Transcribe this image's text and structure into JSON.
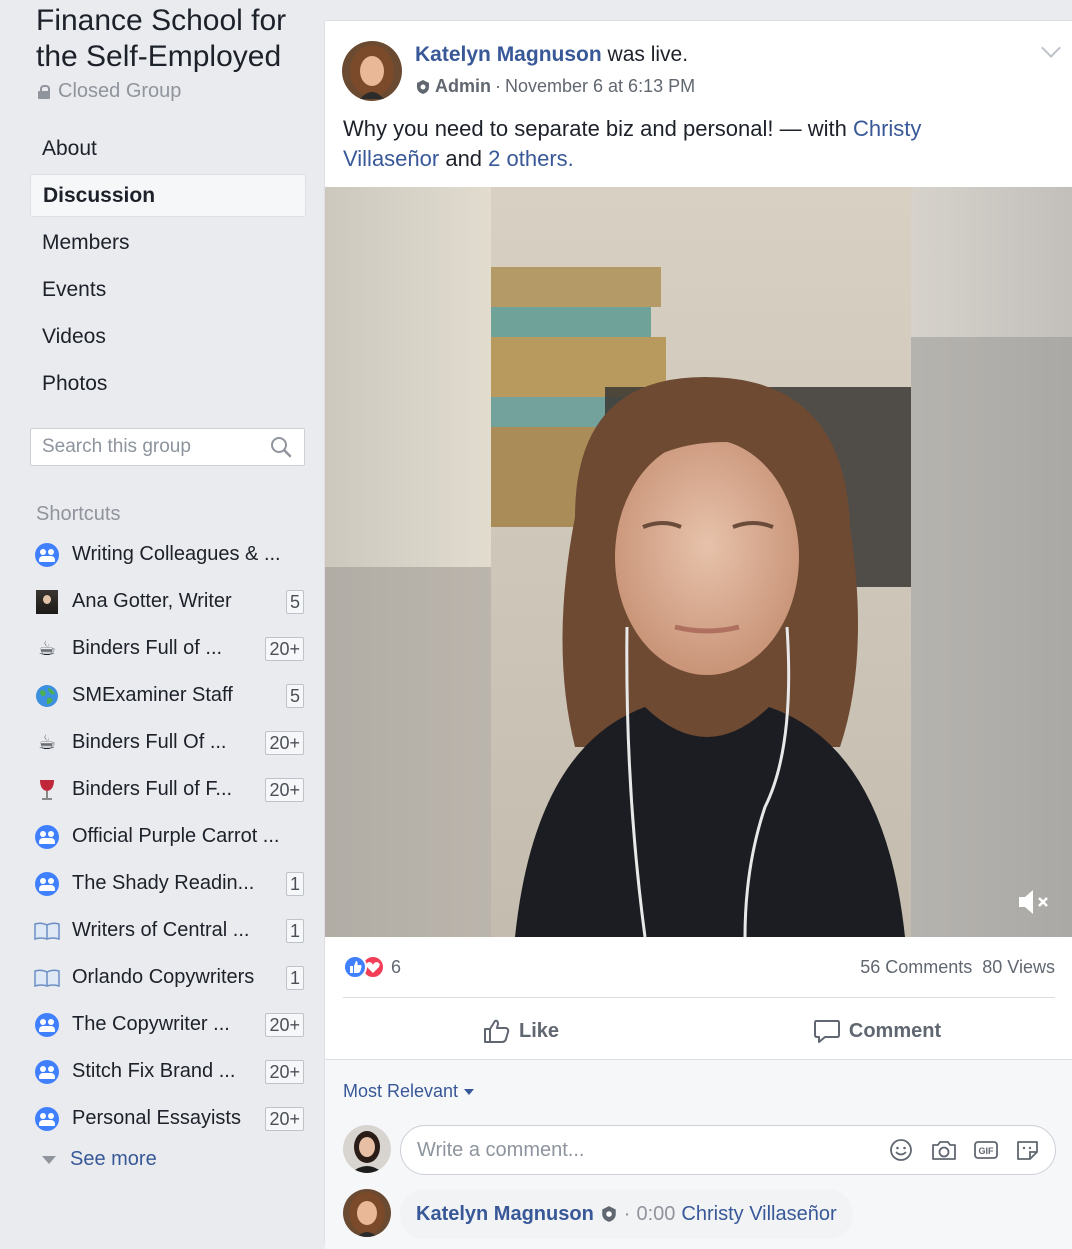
{
  "sidebar": {
    "group_title": "Finance School for the Self-Employed",
    "privacy": "Closed Group",
    "nav": [
      "About",
      "Discussion",
      "Members",
      "Events",
      "Videos",
      "Photos"
    ],
    "active_nav": "Discussion",
    "search_placeholder": "Search this group",
    "shortcuts_heading": "Shortcuts",
    "shortcuts": [
      {
        "label": "Writing Colleagues & ...",
        "badge": "",
        "icon": "group-icon"
      },
      {
        "label": "Ana Gotter, Writer",
        "badge": "5",
        "icon": "profile-thumb-icon"
      },
      {
        "label": "Binders Full of ...",
        "badge": "20+",
        "icon": "coffee-icon"
      },
      {
        "label": "SMExaminer Staff",
        "badge": "5",
        "icon": "globe-icon"
      },
      {
        "label": "Binders Full Of ...",
        "badge": "20+",
        "icon": "coffee-icon"
      },
      {
        "label": "Binders Full of F...",
        "badge": "20+",
        "icon": "wine-icon"
      },
      {
        "label": "Official Purple Carrot ...",
        "badge": "",
        "icon": "group-icon"
      },
      {
        "label": "The Shady Readin...",
        "badge": "1",
        "icon": "group-icon"
      },
      {
        "label": "Writers of Central ...",
        "badge": "1",
        "icon": "book-icon"
      },
      {
        "label": "Orlando Copywriters",
        "badge": "1",
        "icon": "book-icon"
      },
      {
        "label": "The Copywriter ...",
        "badge": "20+",
        "icon": "group-icon"
      },
      {
        "label": "Stitch Fix Brand ...",
        "badge": "20+",
        "icon": "group-icon"
      },
      {
        "label": "Personal Essayists",
        "badge": "20+",
        "icon": "group-icon"
      }
    ],
    "see_more": "See more"
  },
  "post": {
    "author": "Katelyn Magnuson",
    "action": "was live.",
    "role": "Admin",
    "separator": "·",
    "timestamp": "November 6 at 6:13 PM",
    "text_prefix": "Why you need to separate biz and personal! — with ",
    "tagged_person": "Christy Villaseñor",
    "text_and": " and ",
    "tagged_others": "2 others",
    "text_suffix": ".",
    "reaction_count": "6",
    "comments": "56 Comments",
    "views": "80 Views",
    "like_label": "Like",
    "comment_label": "Comment",
    "sort_label": "Most Relevant",
    "comment_placeholder": "Write a comment...",
    "reply_author": "Katelyn Magnuson",
    "reply_time": "0:00",
    "reply_tag": "Christy Villaseñor"
  },
  "colors": {
    "link": "#385898",
    "like_blue": "#4080ff",
    "love_red": "#f33e58",
    "page_bg": "#e9ebee"
  }
}
